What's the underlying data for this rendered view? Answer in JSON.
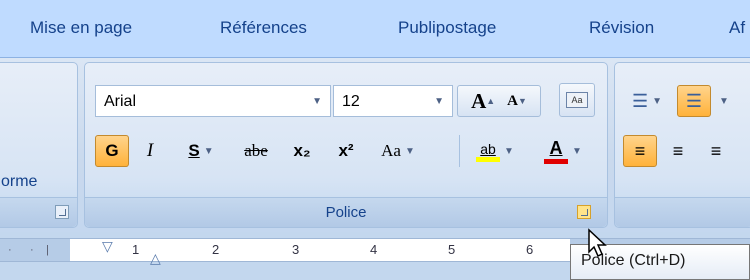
{
  "tabs": [
    "Mise en page",
    "Références",
    "Publipostage",
    "Révision",
    "Af"
  ],
  "left_group": {
    "label_partial": "orme"
  },
  "font_group": {
    "font_name": "Arial",
    "font_size": "12",
    "group_label": "Police",
    "bold": "G",
    "italic": "I",
    "underline": "S",
    "strike": "abe",
    "subscript": "x₂",
    "superscript": "x²",
    "case": "Aa",
    "highlight": "ab",
    "font_color": "A",
    "grow": "A",
    "shrink": "A"
  },
  "ruler": {
    "numbers": [
      "1",
      "2",
      "3",
      "4",
      "5",
      "6"
    ]
  },
  "tooltip": "Police (Ctrl+D)",
  "colors": {
    "accent_orange": "#ffb23a",
    "highlight_yellow": "#ffff00",
    "font_red": "#e00000",
    "label_blue": "#15428b"
  }
}
